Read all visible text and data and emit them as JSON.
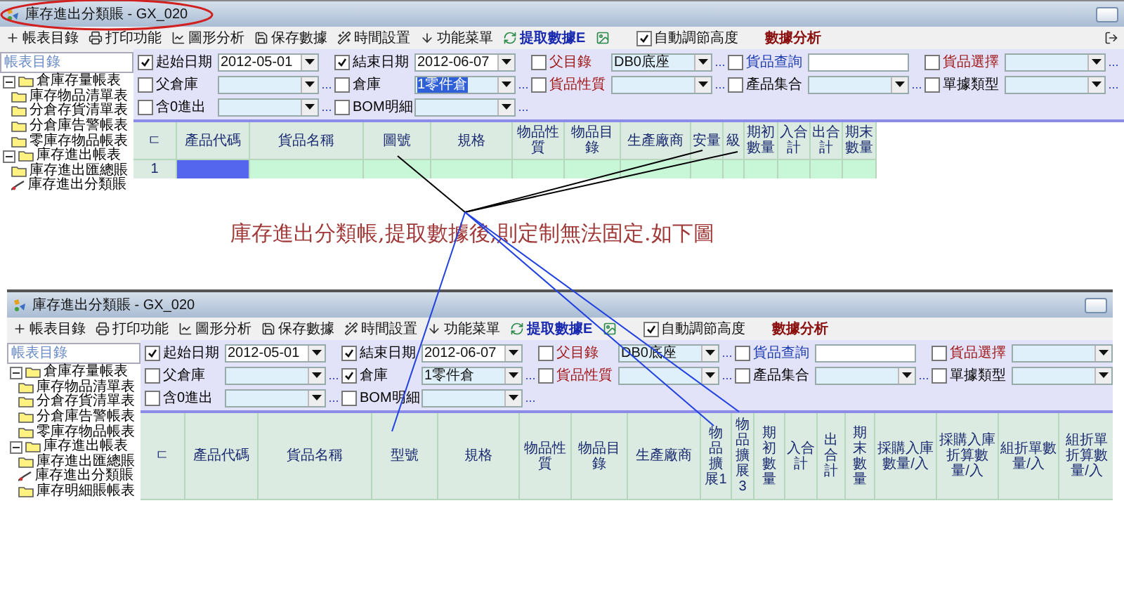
{
  "windows": [
    {
      "title": "庫存進出分類賬 - GX_020",
      "toolbar": [
        {
          "kind": "tool",
          "label": "帳表目錄"
        },
        {
          "kind": "tool",
          "label": "打印功能"
        },
        {
          "kind": "tool",
          "label": "圖形分析"
        },
        {
          "kind": "tool",
          "label": "保存數據"
        },
        {
          "kind": "tool",
          "label": "時間設置"
        },
        {
          "kind": "tool",
          "label": "功能菜單"
        },
        {
          "kind": "action",
          "label": "提取數據E"
        },
        {
          "kind": "toggle",
          "label": "自動調節高度",
          "checked": true
        },
        {
          "kind": "menu",
          "label": "數據分析"
        }
      ],
      "sidebar": {
        "header": "帳表目錄",
        "items": [
          {
            "label": "倉庫存量帳表",
            "expanded": true,
            "children": [
              {
                "label": "庫存物品清單表",
                "kind": "folder"
              },
              {
                "label": "分倉存貨清單表",
                "kind": "folder"
              },
              {
                "label": "分倉庫告警帳表",
                "kind": "folder"
              },
              {
                "label": "零庫存物品帳表",
                "kind": "folder"
              }
            ]
          },
          {
            "label": "庫存進出帳表",
            "expanded": true,
            "children": [
              {
                "label": "庫存進出匯總賬",
                "kind": "folder"
              },
              {
                "label": "庫存進出分類賬",
                "kind": "report"
              }
            ]
          }
        ]
      },
      "filters": [
        [
          {
            "label": "起始日期",
            "checked": true,
            "color": "#000000",
            "kind": "date",
            "value": "2012-05-01",
            "highlighted": false
          },
          {
            "label": "結束日期",
            "checked": true,
            "color": "#000000",
            "kind": "date",
            "value": "2012-06-07",
            "highlighted": false
          },
          {
            "label": "父目錄",
            "checked": false,
            "color": "#a01818",
            "kind": "combo",
            "value": "DB0底座",
            "highlighted": false,
            "more": "..."
          },
          {
            "label": "貨品查詢",
            "checked": false,
            "color": "#1a3ab0",
            "kind": "text"
          },
          {
            "label": "貨品選擇",
            "checked": false,
            "color": "#a01818",
            "kind": "combo",
            "more": "..."
          }
        ],
        [
          {
            "label": "父倉庫",
            "checked": false,
            "color": "#000000",
            "kind": "combo",
            "more": "..."
          },
          {
            "label": "倉庫",
            "checked": false,
            "color": "#000000",
            "kind": "combo",
            "value": "1零件倉",
            "highlighted": true,
            "more": "..."
          },
          {
            "label": "貨品性質",
            "checked": false,
            "color": "#a01818",
            "kind": "combo",
            "more": "..."
          },
          {
            "label": "產品集合",
            "checked": false,
            "color": "#000000",
            "kind": "combo",
            "more": "..."
          },
          {
            "label": "單據類型",
            "checked": false,
            "color": "#000000",
            "kind": "combo",
            "more": "..."
          }
        ],
        [
          {
            "label": "含0進出",
            "checked": false,
            "color": "#000000",
            "kind": "combo",
            "more": "..."
          },
          {
            "label": "BOM明細",
            "checked": false,
            "color": "#000000",
            "kind": "combo",
            "more": "..."
          }
        ]
      ],
      "grid": {
        "columns": [
          "ㄷ",
          "產品代碼",
          "貨品名稱",
          "圖號",
          "規格",
          "物品性質",
          "物品目錄",
          "生產廠商",
          "安量",
          "級",
          "期初數量",
          "入合計",
          "出合計",
          "期末數量"
        ],
        "rows": [
          {
            "cells": [
              {
                "kind": "number",
                "text": "1"
              },
              {
                "kind": "cell",
                "selected": true
              },
              {
                "kind": "cell",
                "selected": false
              },
              {
                "kind": "cell",
                "selected": false
              },
              {
                "kind": "cell",
                "selected": false
              },
              {
                "kind": "cell",
                "selected": false
              },
              {
                "kind": "cell",
                "selected": false
              },
              {
                "kind": "cell",
                "selected": false
              },
              {
                "kind": "cell",
                "selected": false
              },
              {
                "kind": "cell",
                "selected": false
              },
              {
                "kind": "cell",
                "selected": false
              },
              {
                "kind": "cell",
                "selected": false
              },
              {
                "kind": "cell",
                "selected": false
              },
              {
                "kind": "cell",
                "selected": false
              }
            ]
          }
        ]
      }
    },
    {
      "title": "庫存進出分類賬 - GX_020",
      "toolbar": [
        {
          "kind": "tool",
          "label": "帳表目錄"
        },
        {
          "kind": "tool",
          "label": "打印功能"
        },
        {
          "kind": "tool",
          "label": "圖形分析"
        },
        {
          "kind": "tool",
          "label": "保存數據"
        },
        {
          "kind": "tool",
          "label": "時間設置"
        },
        {
          "kind": "tool",
          "label": "功能菜單"
        },
        {
          "kind": "action",
          "label": "提取數據E"
        },
        {
          "kind": "toggle",
          "label": "自動調節高度",
          "checked": true
        },
        {
          "kind": "menu",
          "label": "數據分析"
        }
      ],
      "sidebar": {
        "header": "帳表目錄",
        "items": [
          {
            "label": "倉庫存量帳表",
            "expanded": true,
            "children": [
              {
                "label": "庫存物品清單表",
                "kind": "folder"
              },
              {
                "label": "分倉存貨清單表",
                "kind": "folder"
              },
              {
                "label": "分倉庫告警帳表",
                "kind": "folder"
              },
              {
                "label": "零庫存物品帳表",
                "kind": "folder"
              }
            ]
          },
          {
            "label": "庫存進出帳表",
            "expanded": true,
            "children": [
              {
                "label": "庫存進出匯總賬",
                "kind": "folder"
              },
              {
                "label": "庫存進出分類賬",
                "kind": "report"
              },
              {
                "label": "庫存明細賬帳表",
                "kind": "folder"
              }
            ]
          }
        ]
      },
      "filters": [
        [
          {
            "label": "起始日期",
            "checked": true,
            "color": "#000000",
            "kind": "date",
            "value": "2012-05-01",
            "highlighted": false
          },
          {
            "label": "結束日期",
            "checked": true,
            "color": "#000000",
            "kind": "date",
            "value": "2012-06-07",
            "highlighted": false
          },
          {
            "label": "父目錄",
            "checked": false,
            "color": "#a01818",
            "kind": "combo",
            "value": "DB0底座",
            "highlighted": false,
            "more": "..."
          },
          {
            "label": "貨品查詢",
            "checked": false,
            "color": "#1a3ab0",
            "kind": "text"
          },
          {
            "label": "貨品選擇",
            "checked": false,
            "color": "#a01818",
            "kind": "combo"
          }
        ],
        [
          {
            "label": "父倉庫",
            "checked": false,
            "color": "#000000",
            "kind": "combo",
            "more": "..."
          },
          {
            "label": "倉庫",
            "checked": true,
            "color": "#000000",
            "kind": "combo",
            "value": "1零件倉",
            "highlighted": false,
            "more": "..."
          },
          {
            "label": "貨品性質",
            "checked": false,
            "color": "#a01818",
            "kind": "combo",
            "more": "..."
          },
          {
            "label": "產品集合",
            "checked": false,
            "color": "#000000",
            "kind": "combo",
            "more": "..."
          },
          {
            "label": "單據類型",
            "checked": false,
            "color": "#000000",
            "kind": "combo"
          }
        ],
        [
          {
            "label": "含0進出",
            "checked": false,
            "color": "#000000",
            "kind": "combo",
            "more": "..."
          },
          {
            "label": "BOM明細",
            "checked": false,
            "color": "#000000",
            "kind": "combo",
            "more": "..."
          }
        ]
      ],
      "grid": {
        "columns": [
          "ㄷ",
          "產品代碼",
          "貨品名稱",
          "型號",
          "規格",
          "物品性質",
          "物品目錄",
          "生產廠商",
          "物品擴展1",
          "物品擴展3",
          "期初數量",
          "入合計",
          "出合計",
          "期末數量",
          "採購入庫數量/入",
          "採購入庫折算數量/入",
          "組折單數量/入",
          "組折單折算數量/入"
        ]
      }
    }
  ],
  "annotation": {
    "text": "庫存進出分類帳,提取數據後,則定制無法固定.如下圖"
  }
}
